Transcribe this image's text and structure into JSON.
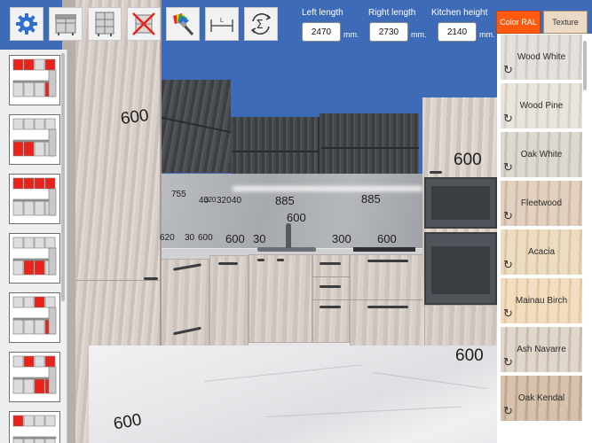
{
  "toolbar": {
    "settings_icon": "gear-icon",
    "cabinets_icon": "base-cabinet-icon",
    "tall_cabinet_icon": "tall-cabinet-icon",
    "delete_icon": "delete-cabinet-icon",
    "paint_icon": "paint-palette-icon",
    "dimension_icon": "dimension-ruler-icon",
    "summary_icon": "sigma-summary-icon"
  },
  "dimensions_form": {
    "left_length": {
      "label": "Left length",
      "value": "2470",
      "unit": "mm."
    },
    "right_length": {
      "label": "Right length",
      "value": "2730",
      "unit": "mm."
    },
    "kitchen_height": {
      "label": "Kitchen height",
      "value": "2140",
      "unit": "mm."
    }
  },
  "tabs": {
    "color_ral": "Color RAL",
    "texture": "Texture",
    "active": "Color RAL"
  },
  "textures": [
    {
      "name": "Wood White",
      "color": "#e4e1dc",
      "grain": "#d1cdc7"
    },
    {
      "name": "Wood Pine",
      "color": "#e9e4dc",
      "grain": "#d7d0c5"
    },
    {
      "name": "Oak White",
      "color": "#ddd8d0",
      "grain": "#c9c3b9"
    },
    {
      "name": "Fleetwood",
      "color": "#e2d1c0",
      "grain": "#cdb9a4"
    },
    {
      "name": "Acacia",
      "color": "#ecdcc2",
      "grain": "#dcc7a6"
    },
    {
      "name": "Mainau Birch",
      "color": "#f2ddc0",
      "grain": "#e4caa4"
    },
    {
      "name": "Ash Navarre",
      "color": "#dfd6cc",
      "grain": "#cabdb0"
    },
    {
      "name": "Oak Kendal",
      "color": "#d6c2ad",
      "grain": "#c0a88f"
    }
  ],
  "kitchen_labels": {
    "tall_left_top": "600",
    "tall_left_bottom": "600",
    "tall_right_top": "600",
    "right_bottom": "600",
    "upper_left_a": "755",
    "upper_left_b": "40",
    "upper_left_c": "320",
    "upper_left_d": "320",
    "upper_left_e": "40",
    "upper_mid": "885",
    "upper_right": "885",
    "sink_width": "600",
    "base_a": "620",
    "base_b": "30",
    "base_c": "600",
    "base_d": "600",
    "base_e": "30",
    "base_f": "300",
    "base_g": "600"
  },
  "layouts": [
    {
      "id": "layout-1"
    },
    {
      "id": "layout-2"
    },
    {
      "id": "layout-3"
    },
    {
      "id": "layout-4"
    },
    {
      "id": "layout-5"
    },
    {
      "id": "layout-6"
    },
    {
      "id": "layout-7"
    }
  ],
  "colors": {
    "background_blue": "#3e6bb7",
    "accent_red": "#e8231b",
    "active_tab": "#ff5a0f"
  }
}
